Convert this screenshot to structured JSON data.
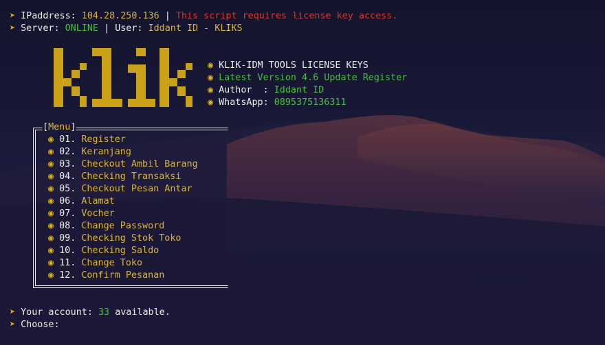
{
  "colors": {
    "accent": "#e0b020",
    "green": "#44c23c",
    "red": "#d9352a",
    "text": "#ececec",
    "background": "#171733"
  },
  "header": {
    "arrow_icon": "arrow-icon",
    "ip_label": "IPaddress:",
    "ip_value": "104.28.250.136",
    "separator": "|",
    "license_warning": "This script requires license key access.",
    "server_label": "Server:",
    "server_status": "ONLINE",
    "user_label": "User:",
    "user_value": "Iddant ID - KLIKS"
  },
  "logo": {
    "text": "klik"
  },
  "info": {
    "bullet_icon": "bullet-icon",
    "title": "KLIK-IDM TOOLS LICENSE KEYS",
    "version": "Latest Version 4.6 Update Register",
    "author_label": "Author  :",
    "author_value": "Iddant ID",
    "whatsapp_label": "WhatsApp:",
    "whatsapp_value": "0895375136311"
  },
  "menu": {
    "title": "Menu",
    "items": [
      {
        "num": "01.",
        "label": "Register"
      },
      {
        "num": "02.",
        "label": "Keranjang"
      },
      {
        "num": "03.",
        "label": "Checkout Ambil Barang"
      },
      {
        "num": "04.",
        "label": "Checking Transaksi"
      },
      {
        "num": "05.",
        "label": "Checkout Pesan Antar"
      },
      {
        "num": "06.",
        "label": "Alamat"
      },
      {
        "num": "07.",
        "label": "Vocher"
      },
      {
        "num": "08.",
        "label": "Change Password"
      },
      {
        "num": "09.",
        "label": "Checking Stok Toko"
      },
      {
        "num": "10.",
        "label": "Checking Saldo"
      },
      {
        "num": "11.",
        "label": "Change Toko"
      },
      {
        "num": "12.",
        "label": "Confirm Pesanan"
      }
    ]
  },
  "footer": {
    "account_label": "Your account:",
    "account_count": "33",
    "account_suffix": "available.",
    "choose_label": "Choose:"
  }
}
